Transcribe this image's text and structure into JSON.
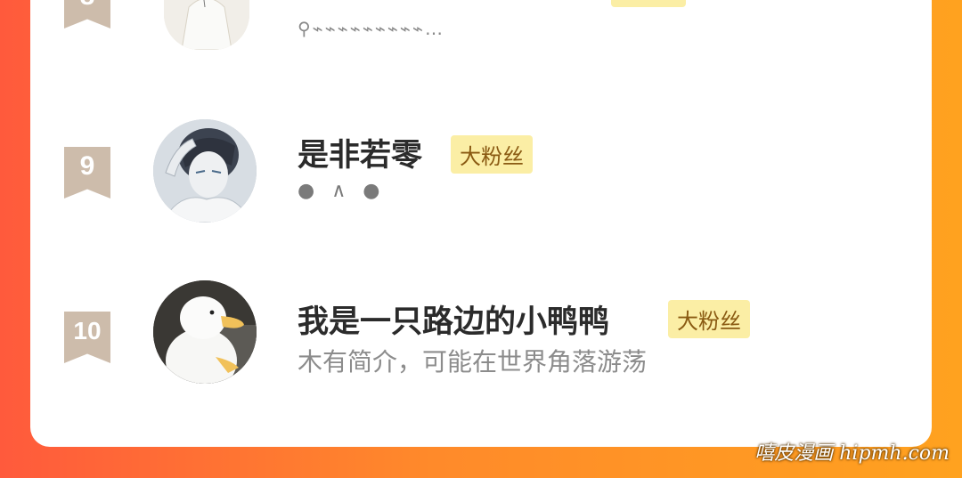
{
  "rankings": [
    {
      "rank": "8",
      "name": "",
      "badge": "",
      "bio": "⚲⌁⌁⌁⌁⌁⌁⌁⌁⌁…"
    },
    {
      "rank": "9",
      "name": "是非若零",
      "badge": "大粉丝",
      "bio": "● ∧ ●"
    },
    {
      "rank": "10",
      "name": "我是一只路边的小鸭鸭",
      "badge": "大粉丝",
      "bio": "木有简介，可能在世界角落游荡"
    }
  ],
  "watermark": "嘻皮漫画 hipmh.com",
  "colors": {
    "background_left": "#ff5a3c",
    "background_right": "#ffa21f",
    "badge_bg": "#fbeea5",
    "badge_text": "#8a5a12",
    "rank_ribbon": "#cdbcab"
  }
}
